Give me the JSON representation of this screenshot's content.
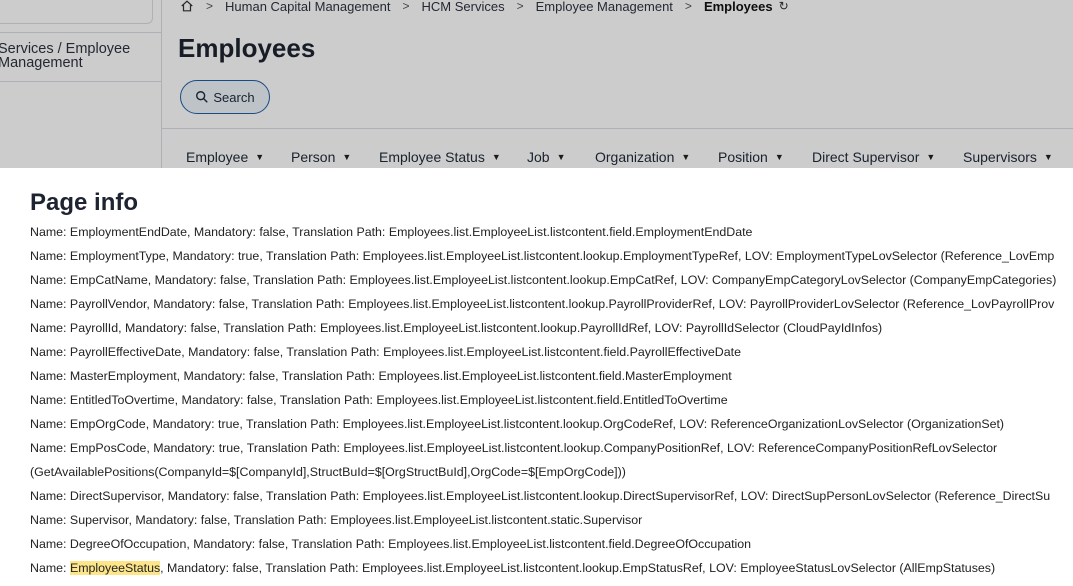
{
  "breadcrumb": {
    "items": [
      "Human Capital Management",
      "HCM Services",
      "Employee Management"
    ],
    "current": "Employees"
  },
  "left_nav": {
    "text": "Services / Employee Management"
  },
  "page": {
    "title": "Employees",
    "search_label": "Search"
  },
  "filters": [
    "Employee",
    "Person",
    "Employee Status",
    "Job",
    "Organization",
    "Position",
    "Direct Supervisor",
    "Supervisors"
  ],
  "info": {
    "title": "Page info",
    "lines": [
      "Name: EmploymentEndDate, Mandatory: false, Translation Path: Employees.list.EmployeeList.listcontent.field.EmploymentEndDate",
      "Name: EmploymentType, Mandatory: true, Translation Path: Employees.list.EmployeeList.listcontent.lookup.EmploymentTypeRef, LOV: EmploymentTypeLovSelector (Reference_LovEmp",
      "Name: EmpCatName, Mandatory: false, Translation Path: Employees.list.EmployeeList.listcontent.lookup.EmpCatRef, LOV: CompanyEmpCategoryLovSelector (CompanyEmpCategories)",
      "Name: PayrollVendor, Mandatory: false, Translation Path: Employees.list.EmployeeList.listcontent.lookup.PayrollProviderRef, LOV: PayrollProviderLovSelector (Reference_LovPayrollProv",
      "Name: PayrollId, Mandatory: false, Translation Path: Employees.list.EmployeeList.listcontent.lookup.PayrollIdRef, LOV: PayrollIdSelector (CloudPayIdInfos)",
      "Name: PayrollEffectiveDate, Mandatory: false, Translation Path: Employees.list.EmployeeList.listcontent.field.PayrollEffectiveDate",
      "Name: MasterEmployment, Mandatory: false, Translation Path: Employees.list.EmployeeList.listcontent.field.MasterEmployment",
      "Name: EntitledToOvertime, Mandatory: false, Translation Path: Employees.list.EmployeeList.listcontent.field.EntitledToOvertime",
      "Name: EmpOrgCode, Mandatory: true, Translation Path: Employees.list.EmployeeList.listcontent.lookup.OrgCodeRef, LOV: ReferenceOrganizationLovSelector (OrganizationSet)",
      "Name: EmpPosCode, Mandatory: true, Translation Path: Employees.list.EmployeeList.listcontent.lookup.CompanyPositionRef, LOV: ReferenceCompanyPositionRefLovSelector",
      "(GetAvailablePositions(CompanyId=$[CompanyId],StructBuId=$[OrgStructBuId],OrgCode=$[EmpOrgCode]))",
      "Name: DirectSupervisor, Mandatory: false, Translation Path: Employees.list.EmployeeList.listcontent.lookup.DirectSupervisorRef, LOV: DirectSupPersonLovSelector (Reference_DirectSu",
      "Name: Supervisor, Mandatory: false, Translation Path: Employees.list.EmployeeList.listcontent.static.Supervisor",
      "Name: DegreeOfOccupation, Mandatory: false, Translation Path: Employees.list.EmployeeList.listcontent.field.DegreeOfOccupation"
    ],
    "last_line": {
      "prefix": "Name: ",
      "highlight": "EmployeeStatus",
      "suffix": ", Mandatory: false, Translation Path: Employees.list.EmployeeList.listcontent.lookup.EmpStatusRef, LOV: EmployeeStatusLovSelector (AllEmpStatuses)"
    }
  }
}
